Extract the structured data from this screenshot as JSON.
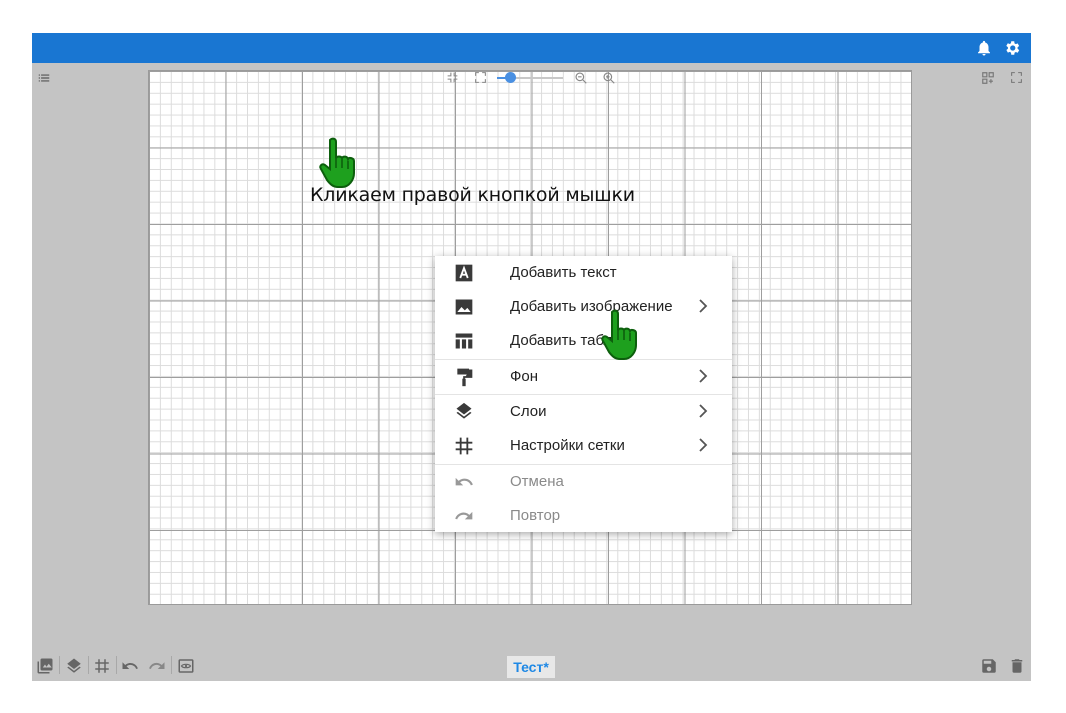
{
  "topbar": {
    "icons": [
      "bell-icon",
      "gear-icon"
    ],
    "color": "#1976d2"
  },
  "toolbar": {
    "left_icons": [
      "list-icon"
    ],
    "right_icons": [
      "grid-add-icon",
      "fullscreen-icon"
    ],
    "zoom_icons": [
      "collapse-icon",
      "expand-icon",
      "zoom-out-icon",
      "zoom-in-icon"
    ],
    "zoom_level": 0.2
  },
  "caption": "Кликаем правой кнопкой мышки",
  "context_menu": {
    "items": [
      {
        "label": "Добавить текст",
        "icon": "text-icon",
        "submenu": false,
        "disabled": false
      },
      {
        "label": "Добавить изображение",
        "icon": "image-icon",
        "submenu": true,
        "disabled": false
      },
      {
        "label": "Добавить таблицу",
        "icon": "table-icon",
        "submenu": false,
        "disabled": false
      },
      {
        "label": "Фон",
        "icon": "paint-roller-icon",
        "submenu": true,
        "disabled": false
      },
      {
        "label": "Слои",
        "icon": "layers-icon",
        "submenu": true,
        "disabled": false
      },
      {
        "label": "Настройки сетки",
        "icon": "grid-icon",
        "submenu": true,
        "disabled": false
      },
      {
        "label": "Отмена",
        "icon": "undo-icon",
        "submenu": false,
        "disabled": true
      },
      {
        "label": "Повтор",
        "icon": "redo-icon",
        "submenu": false,
        "disabled": true
      }
    ]
  },
  "bottom_bar": {
    "left_icons": [
      "images-icon",
      "layers-icon",
      "grid-icon",
      "undo-icon",
      "redo-icon",
      "preview-icon"
    ],
    "tab_label": "Тест*",
    "right_icons": [
      "save-icon",
      "delete-icon"
    ]
  },
  "colors": {
    "accent": "#1976d2",
    "hand": "#1ea01e",
    "background": "#c4c4c4"
  }
}
